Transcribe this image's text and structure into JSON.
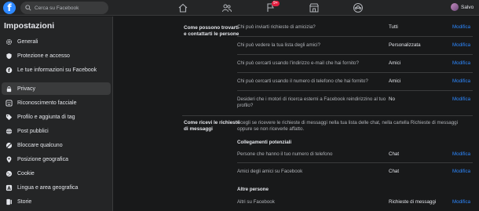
{
  "topbar": {
    "logo": "f",
    "search_placeholder": "Cerca su Facebook",
    "nav_icons": [
      "home-icon",
      "friends-icon",
      "flag-icon",
      "marketplace-icon",
      "groups-icon"
    ],
    "flag_badge": "9+",
    "user_name": "Salvo"
  },
  "sidebar": {
    "title": "Impostazioni",
    "items": [
      {
        "label": "Generali",
        "icon": "gear-icon"
      },
      {
        "label": "Protezione e accesso",
        "icon": "shield-icon"
      },
      {
        "label": "Le tue informazioni su Facebook",
        "icon": "facebook-icon"
      },
      {
        "label": "Privacy",
        "icon": "lock-icon",
        "active": true
      },
      {
        "label": "Riconoscimento facciale",
        "icon": "face-icon"
      },
      {
        "label": "Profilo e aggiunta di tag",
        "icon": "tag-icon"
      },
      {
        "label": "Post pubblici",
        "icon": "globe-icon"
      },
      {
        "label": "Bloccare qualcuno",
        "icon": "block-icon"
      },
      {
        "label": "Posizione geografica",
        "icon": "location-icon"
      },
      {
        "label": "Cookie",
        "icon": "cookie-icon"
      },
      {
        "label": "Lingua e area geografica",
        "icon": "language-icon"
      },
      {
        "label": "Storie",
        "icon": "stories-icon"
      }
    ]
  },
  "section1": {
    "label": "Come possono trovarti e contattarti le persone",
    "rows": [
      {
        "question": "Chi può inviarti richieste di amicizia?",
        "value": "Tutti",
        "edit": "Modifica"
      },
      {
        "question": "Chi può vedere la tua lista degli amici?",
        "value": "Personalizzata",
        "edit": "Modifica"
      },
      {
        "question": "Chi può cercarti usando l'indirizzo e-mail che hai fornito?",
        "value": "Amici",
        "edit": "Modifica"
      },
      {
        "question": "Chi può cercarti usando il numero di telefono che hai fornito?",
        "value": "Amici",
        "edit": "Modifica"
      },
      {
        "question": "Desideri che i motori di ricerca esterni a Facebook reindirizzino al tuo profilo?",
        "value": "No",
        "edit": "Modifica"
      }
    ]
  },
  "section2": {
    "label": "Come ricevi le richieste di messaggi",
    "description": "Scegli se ricevere le richieste di messaggi nella tua lista delle chat, nella cartella Richieste di messaggi oppure se non riceverle affatto.",
    "group1_title": "Collegamenti potenziali",
    "group1_rows": [
      {
        "question": "Persone che hanno il tuo numero di telefono",
        "value": "Chat",
        "edit": "Modifica"
      },
      {
        "question": "Amici degli amici su Facebook",
        "value": "Chat",
        "edit": "Modifica"
      }
    ],
    "group2_title": "Altre persone",
    "group2_rows": [
      {
        "question": "Altri su Facebook",
        "value": "Richieste di messaggi",
        "edit": "Modifica"
      }
    ]
  },
  "colors": {
    "accent": "#2d88ff",
    "bg": "#18191a",
    "panel": "#242526",
    "badge": "#e41e3f"
  }
}
